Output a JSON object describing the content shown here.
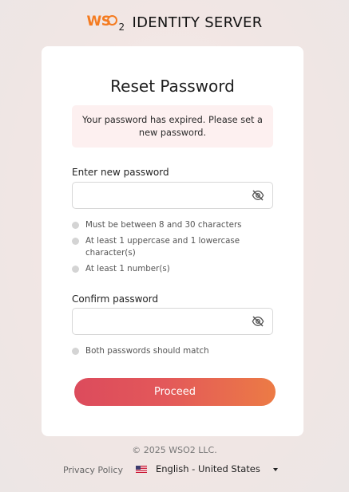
{
  "brand": {
    "logo_ws": "WS",
    "logo_two": "2",
    "title": "IDENTITY SERVER"
  },
  "card": {
    "title": "Reset Password",
    "alert": "Your password has expired. Please set a new password.",
    "new_password": {
      "label": "Enter new password",
      "value": "",
      "placeholder": ""
    },
    "rules": [
      "Must be between 8 and 30 characters",
      "At least 1 uppercase and 1 lowercase character(s)",
      "At least 1 number(s)"
    ],
    "confirm_password": {
      "label": "Confirm password",
      "value": "",
      "placeholder": ""
    },
    "match_rule": "Both passwords should match",
    "proceed_label": "Proceed"
  },
  "footer": {
    "copyright": "© 2025 WSO2 LLC.",
    "privacy": "Privacy Policy",
    "language": "English - United States"
  },
  "colors": {
    "brand_orange": "#f47b20",
    "button_start": "#dc4b5c",
    "button_end": "#ec7b45",
    "alert_bg": "#fdf0f0"
  },
  "icons": {
    "toggle_visibility": "eye-off-icon",
    "dropdown": "chevron-down-icon",
    "flag": "us-flag-icon"
  }
}
